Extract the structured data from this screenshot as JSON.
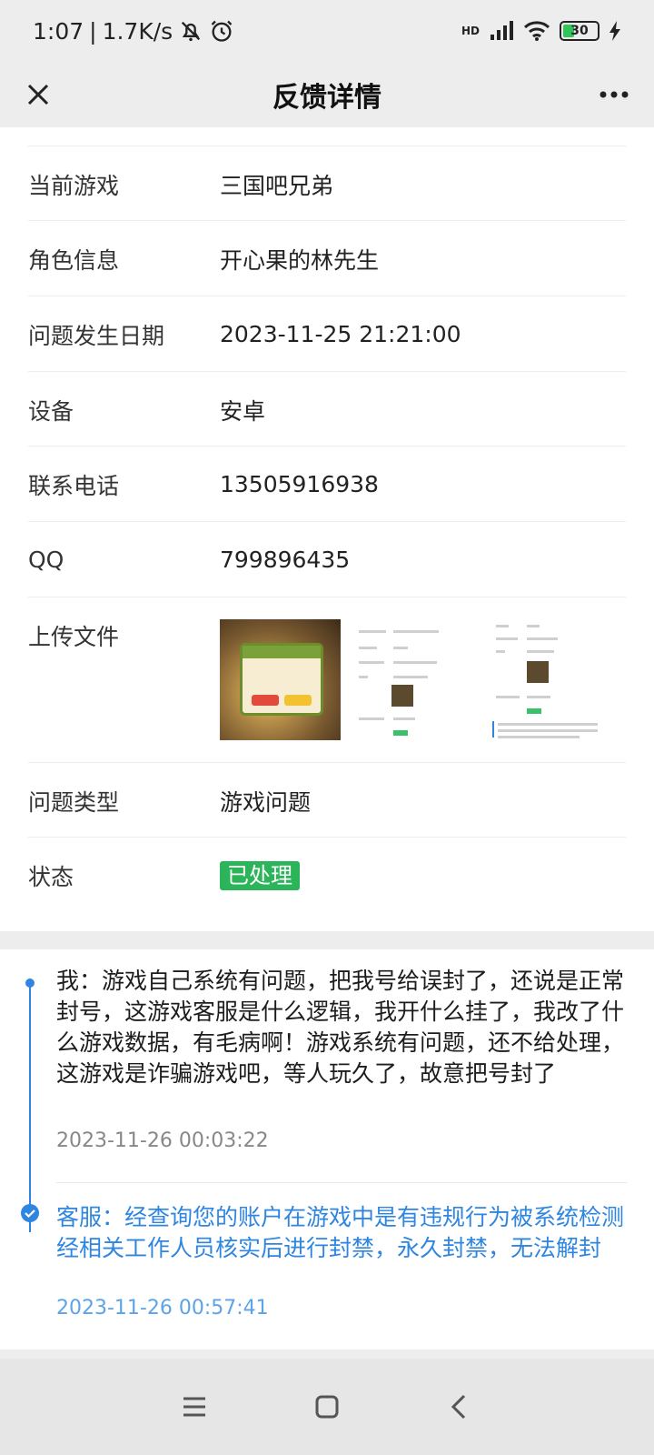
{
  "status_bar": {
    "time": "1:07",
    "separator": "|",
    "speed": "1.7K/s",
    "network": "HD",
    "battery": "30",
    "icons": [
      "mute-bell-icon",
      "alarm-icon",
      "signal-icon",
      "wifi-icon",
      "battery-icon",
      "charging-icon"
    ]
  },
  "nav": {
    "title": "反馈详情",
    "close_icon": "close-icon",
    "more_icon": "more-icon"
  },
  "details": {
    "game": {
      "label": "当前游戏",
      "value": "三国吧兄弟"
    },
    "role": {
      "label": "角色信息",
      "value": "开心果的林先生"
    },
    "date": {
      "label": "问题发生日期",
      "value": "2023-11-25 21:21:00"
    },
    "device": {
      "label": "设备",
      "value": "安卓"
    },
    "phone": {
      "label": "联系电话",
      "value": "13505916938"
    },
    "qq": {
      "label": "QQ",
      "value": "799896435"
    },
    "files": {
      "label": "上传文件",
      "count": 3
    },
    "type": {
      "label": "问题类型",
      "value": "游戏问题"
    },
    "status": {
      "label": "状态",
      "value": "已处理",
      "color": "#2bb45a"
    }
  },
  "conversation": {
    "user": {
      "text": "我：游戏自己系统有问题，把我号给误封了，还说是正常封号，这游戏客服是什么逻辑，我开什么挂了，我改了什么游戏数据，有毛病啊！游戏系统有问题，还不给处理，这游戏是诈骗游戏吧，等人玩久了，故意把号封了",
      "time": "2023-11-26 00:03:22"
    },
    "agent": {
      "text": "客服：经查询您的账户在游戏中是有违规行为被系统检测经相关工作人员核实后进行封禁，永久封禁，无法解封",
      "time": "2023-11-26 00:57:41",
      "color": "#2f86e0"
    }
  },
  "system_nav": {
    "icons": [
      "menu-icon",
      "home-icon",
      "back-icon"
    ]
  }
}
